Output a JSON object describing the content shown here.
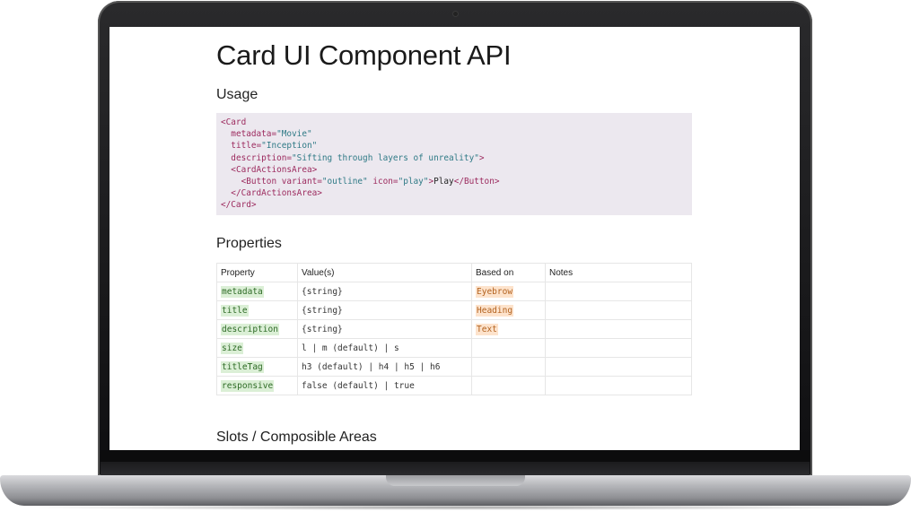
{
  "page": {
    "title": "Card UI Component API",
    "usage_heading": "Usage",
    "properties_heading": "Properties",
    "slots_heading": "Slots / Composible Areas"
  },
  "code": {
    "lines": [
      {
        "indent": "",
        "parts": [
          {
            "t": "tag",
            "v": "<Card"
          }
        ]
      },
      {
        "indent": "  ",
        "parts": [
          {
            "t": "attr",
            "v": "metadata="
          },
          {
            "t": "str",
            "v": "\"Movie\""
          }
        ]
      },
      {
        "indent": "  ",
        "parts": [
          {
            "t": "attr",
            "v": "title="
          },
          {
            "t": "str",
            "v": "\"Inception\""
          }
        ]
      },
      {
        "indent": "  ",
        "parts": [
          {
            "t": "attr",
            "v": "description="
          },
          {
            "t": "str",
            "v": "\"Sifting through layers of unreality\""
          },
          {
            "t": "tag",
            "v": ">"
          }
        ]
      },
      {
        "indent": "  ",
        "parts": [
          {
            "t": "tag",
            "v": "<CardActionsArea>"
          }
        ]
      },
      {
        "indent": "    ",
        "parts": [
          {
            "t": "tag",
            "v": "<Button "
          },
          {
            "t": "attr",
            "v": "variant="
          },
          {
            "t": "str",
            "v": "\"outline\""
          },
          {
            "t": "attr",
            "v": " icon="
          },
          {
            "t": "str",
            "v": "\"play\""
          },
          {
            "t": "tag",
            "v": ">"
          },
          {
            "t": "txt",
            "v": "Play"
          },
          {
            "t": "tag",
            "v": "</Button>"
          }
        ]
      },
      {
        "indent": "  ",
        "parts": [
          {
            "t": "tag",
            "v": "</CardActionsArea>"
          }
        ]
      },
      {
        "indent": "",
        "parts": [
          {
            "t": "tag",
            "v": "</Card>"
          }
        ]
      }
    ]
  },
  "table": {
    "headers": {
      "property": "Property",
      "values": "Value(s)",
      "based_on": "Based on",
      "notes": "Notes"
    },
    "rows": [
      {
        "property": "metadata",
        "values": "{string}",
        "based_on": "Eyebrow",
        "notes": ""
      },
      {
        "property": "title",
        "values": "{string}",
        "based_on": "Heading",
        "notes": ""
      },
      {
        "property": "description",
        "values": "{string}",
        "based_on": "Text",
        "notes": ""
      },
      {
        "property": "size",
        "values": "l | m (default) | s",
        "based_on": "",
        "notes": ""
      },
      {
        "property": "titleTag",
        "values": "h3 (default) | h4 | h5 | h6",
        "based_on": "",
        "notes": ""
      },
      {
        "property": "responsive",
        "values": "false (default) | true",
        "based_on": "",
        "notes": ""
      }
    ]
  },
  "colors": {
    "code_bg": "#ece8ef",
    "tag": "#9c2a5e",
    "string": "#2f7a86",
    "property_chip_bg": "#dbefd6",
    "property_chip_text": "#2e6b26",
    "based_on_chip_bg": "#fde3cc",
    "based_on_chip_text": "#b3621f"
  }
}
